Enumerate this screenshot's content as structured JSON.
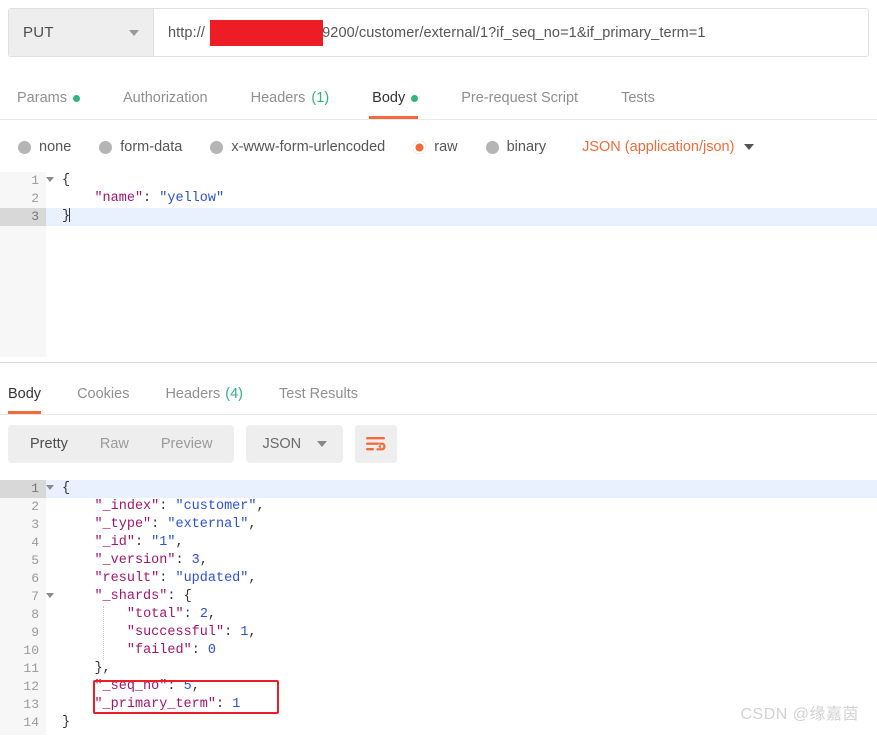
{
  "request": {
    "method": "PUT",
    "method_caret": "chevron-down",
    "url_prefix": "http://",
    "url_redacted_host": "",
    "url_suffix": ":9200/customer/external/1?if_seq_no=1&if_primary_term=1",
    "url_full": "http://:9200/customer/external/1?if_seq_no=1&if_primary_term=1",
    "tabs": [
      {
        "label": "Params",
        "badge_dot": true,
        "active": false
      },
      {
        "label": "Authorization",
        "badge_dot": false,
        "active": false
      },
      {
        "label": "Headers",
        "count": "(1)",
        "badge_dot": false,
        "active": false
      },
      {
        "label": "Body",
        "badge_dot": true,
        "active": true
      },
      {
        "label": "Pre-request Script",
        "badge_dot": false,
        "active": false
      },
      {
        "label": "Tests",
        "badge_dot": false,
        "active": false
      }
    ],
    "body_types": [
      {
        "label": "none",
        "selected": false
      },
      {
        "label": "form-data",
        "selected": false
      },
      {
        "label": "x-www-form-urlencoded",
        "selected": false
      },
      {
        "label": "raw",
        "selected": true
      },
      {
        "label": "binary",
        "selected": false
      }
    ],
    "content_type": "JSON (application/json)",
    "body_lines": [
      {
        "num": "1",
        "fold": true,
        "highlight": false,
        "text": "{"
      },
      {
        "num": "2",
        "fold": false,
        "highlight": false,
        "text": "    \"name\": \"yellow\""
      },
      {
        "num": "3",
        "fold": false,
        "highlight": true,
        "text": "}"
      }
    ],
    "body_text": "{\n    \"name\": \"yellow\"\n}"
  },
  "response": {
    "tabs": [
      {
        "label": "Body",
        "active": true
      },
      {
        "label": "Cookies",
        "active": false
      },
      {
        "label": "Headers",
        "count": "(4)",
        "active": false
      },
      {
        "label": "Test Results",
        "active": false
      }
    ],
    "view_modes": [
      {
        "label": "Pretty",
        "active": true
      },
      {
        "label": "Raw",
        "active": false
      },
      {
        "label": "Preview",
        "active": false
      }
    ],
    "format": "JSON",
    "wrap_icon": "wrap-text-icon",
    "body_lines": [
      {
        "num": "1",
        "fold": true,
        "highlight": true,
        "text": "{"
      },
      {
        "num": "2",
        "fold": false,
        "highlight": false,
        "text": "    \"_index\": \"customer\","
      },
      {
        "num": "3",
        "fold": false,
        "highlight": false,
        "text": "    \"_type\": \"external\","
      },
      {
        "num": "4",
        "fold": false,
        "highlight": false,
        "text": "    \"_id\": \"1\","
      },
      {
        "num": "5",
        "fold": false,
        "highlight": false,
        "text": "    \"_version\": 3,"
      },
      {
        "num": "6",
        "fold": false,
        "highlight": false,
        "text": "    \"result\": \"updated\","
      },
      {
        "num": "7",
        "fold": true,
        "highlight": false,
        "text": "    \"_shards\": {"
      },
      {
        "num": "8",
        "fold": false,
        "highlight": false,
        "text": "        \"total\": 2,"
      },
      {
        "num": "9",
        "fold": false,
        "highlight": false,
        "text": "        \"successful\": 1,"
      },
      {
        "num": "10",
        "fold": false,
        "highlight": false,
        "text": "        \"failed\": 0"
      },
      {
        "num": "11",
        "fold": false,
        "highlight": false,
        "text": "    },"
      },
      {
        "num": "12",
        "fold": false,
        "highlight": false,
        "text": "    \"_seq_no\": 5,"
      },
      {
        "num": "13",
        "fold": false,
        "highlight": false,
        "text": "    \"_primary_term\": 1"
      },
      {
        "num": "14",
        "fold": false,
        "highlight": false,
        "text": "}"
      }
    ],
    "body_json": {
      "_index": "customer",
      "_type": "external",
      "_id": "1",
      "_version": 3,
      "result": "updated",
      "_shards": {
        "total": 2,
        "successful": 1,
        "failed": 0
      },
      "_seq_no": 5,
      "_primary_term": 1
    }
  },
  "annotation": {
    "color": "#ee1c25",
    "highlights_lines": [
      "12",
      "13"
    ]
  },
  "watermark": "CSDN @缘嘉茵",
  "colors": {
    "accent": "#f26b3a",
    "green_dot": "#2eb67d",
    "redaction": "#ee1c25",
    "key": "#a3156d",
    "value": "#2b50d6",
    "line_highlight": "#e8f1fd"
  }
}
